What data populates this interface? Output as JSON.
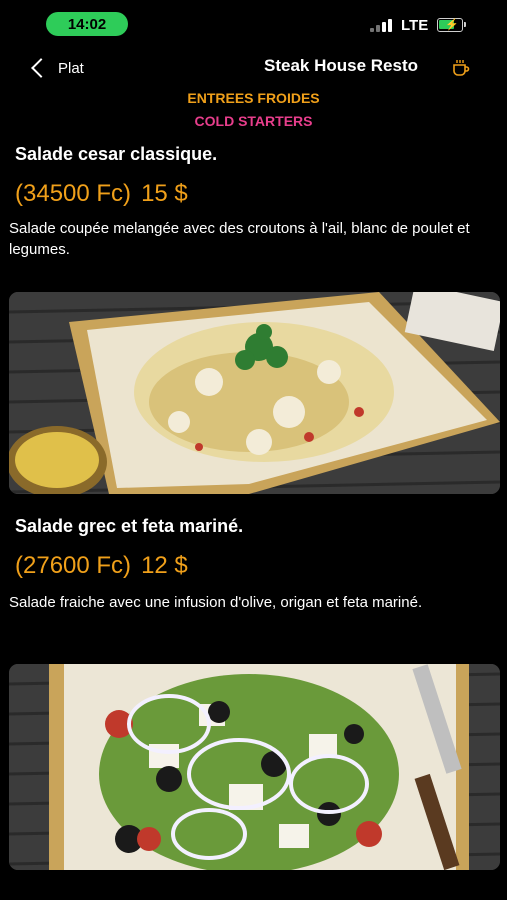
{
  "status_bar": {
    "time": "14:02",
    "network": "LTE",
    "battery_level": 0.7,
    "icons": [
      "signal-icon",
      "battery-charging-icon"
    ]
  },
  "nav": {
    "back_label": "Plat",
    "title": "Steak House Resto",
    "icon": "coffee-cup-icon"
  },
  "section": {
    "title_fr": "ENTREES FROIDES",
    "title_en": "COLD STARTERS"
  },
  "dishes": [
    {
      "name": "Salade cesar classique.",
      "price_fc": "(34500 Fc)",
      "price_usd": "15 $",
      "description": "Salade coupée melangée avec des croutons à l'ail, blanc de poulet et legumes."
    },
    {
      "name": "Salade grec et feta mariné.",
      "price_fc": "(27600 Fc)",
      "price_usd": "12 $",
      "description": "Salade fraiche avec une infusion d'olive, origan et feta mariné."
    }
  ],
  "colors": {
    "accent": "#f0a01a",
    "section_en": "#e83e8c",
    "time_pill": "#2ecc59",
    "background": "#000000"
  }
}
